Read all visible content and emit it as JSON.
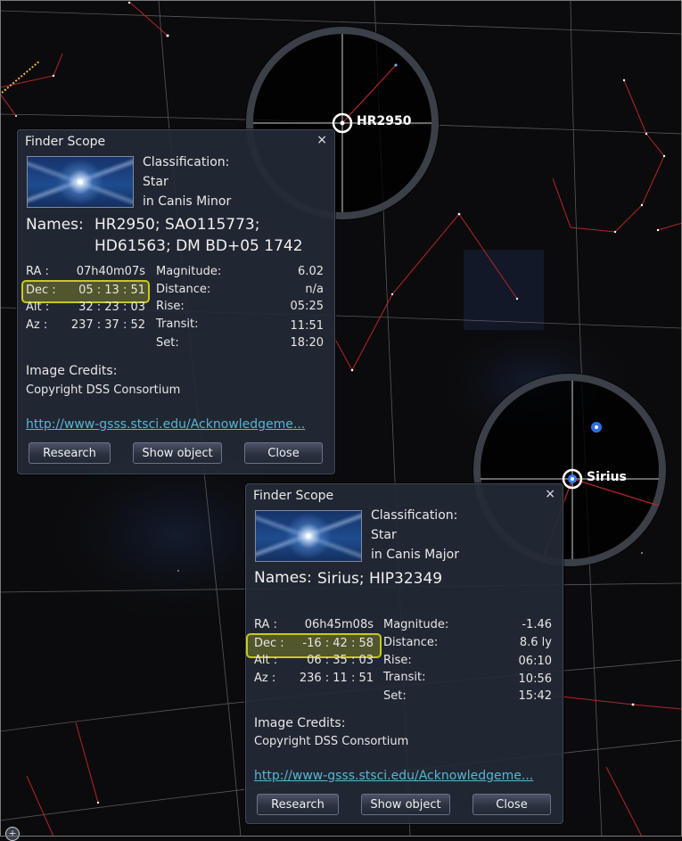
{
  "panel1": {
    "title": "Finder Scope",
    "close": "×",
    "classification_label": "Classification:",
    "classification_value": "Star",
    "constellation": "in Canis Minor",
    "names_label": "Names:",
    "names_line1": "HR2950; SAO115773;",
    "names_line2": "HD61563; DM BD+05 1742",
    "ra_label": "RA :",
    "ra_value": "07h40m07s",
    "dec_label": "Dec :",
    "dec_value": "05 : 13 : 51",
    "alt_label": "Alt :",
    "alt_value": "32 : 23 : 03",
    "az_label": "Az :",
    "az_value": "237 : 37 : 52",
    "magnitude_label": "Magnitude:",
    "magnitude_value": "6.02",
    "distance_label": "Distance:",
    "distance_value": "n/a",
    "rise_label": "Rise:",
    "rise_value": "05:25",
    "transit_label": "Transit:",
    "transit_value": "11:51",
    "set_label": "Set:",
    "set_value": "18:20",
    "credits_label": "Image Credits:",
    "credits_value": "Copyright DSS Consortium",
    "link": "http://www-gsss.stsci.edu/Acknowledgeme...",
    "btn_research": "Research",
    "btn_show": "Show object",
    "btn_close": "Close"
  },
  "panel2": {
    "title": "Finder Scope",
    "close": "×",
    "classification_label": "Classification:",
    "classification_value": "Star",
    "constellation": "in Canis Major",
    "names_label": "Names:",
    "names_line1": "Sirius; HIP32349",
    "ra_label": "RA :",
    "ra_value": "06h45m08s",
    "dec_label": "Dec :",
    "dec_value": "-16 : 42 : 58",
    "alt_label": "Alt :",
    "alt_value": "06 : 35 : 03",
    "az_label": "Az :",
    "az_value": "236 : 11 : 51",
    "magnitude_label": "Magnitude:",
    "magnitude_value": "-1.46",
    "distance_label": "Distance:",
    "distance_value": "8.6 ly",
    "rise_label": "Rise:",
    "rise_value": "06:10",
    "transit_label": "Transit:",
    "transit_value": "10:56",
    "set_label": "Set:",
    "set_value": "15:42",
    "credits_label": "Image Credits:",
    "credits_value": "Copyright DSS Consortium",
    "link": "http://www-gsss.stsci.edu/Acknowledgeme...",
    "btn_research": "Research",
    "btn_show": "Show object",
    "btn_close": "Close"
  },
  "scope1": {
    "star_label": "HR2950"
  },
  "scope2": {
    "star_label": "Sirius"
  },
  "zoom_icon": "zoom-icon",
  "colors": {
    "background": "#0b0b0d",
    "panel": "#242a36",
    "link": "#56b6d2",
    "highlight": "#c9c820",
    "constellation_line": "#b3262b",
    "grid_line": "#8a8a8a"
  }
}
